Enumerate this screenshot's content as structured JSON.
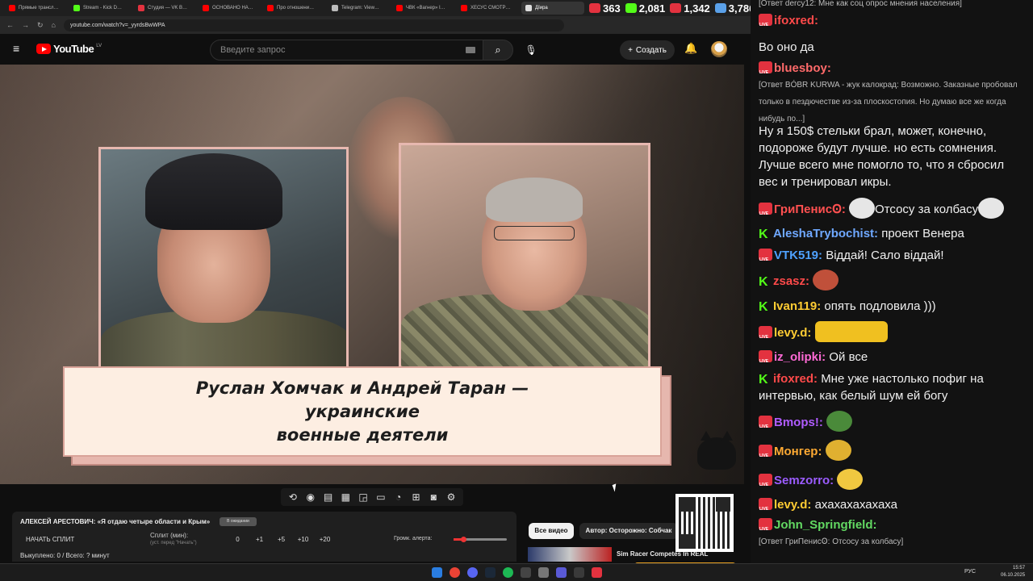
{
  "browser": {
    "tabs": [
      {
        "label": "Прямые трансл…",
        "color": "#ff0000"
      },
      {
        "label": "Stream - Kick D…",
        "color": "#53fc18"
      },
      {
        "label": "Студия — VK В…",
        "color": "#e3323f"
      },
      {
        "label": "ОСНОВАНО НА…",
        "color": "#ff0000"
      },
      {
        "label": "Про отношени…",
        "color": "#ff0000"
      },
      {
        "label": "Telegram: View…",
        "color": "#bbbbbb"
      },
      {
        "label": "ЧВК «Вагнер» I…",
        "color": "#ff0000"
      },
      {
        "label": "ХЕСУС СМОТР…",
        "color": "#ff0000"
      },
      {
        "label": "Дїира",
        "color": "#dddddd"
      }
    ],
    "url": "youtube.com/watch?v=_yyrdsBwWPA"
  },
  "stream_stats": [
    {
      "icon": "youtube-icon",
      "value": "363",
      "color": "#e3323f"
    },
    {
      "icon": "kick-icon",
      "value": "2,081",
      "color": "#53fc18"
    },
    {
      "icon": "vk-live-icon",
      "value": "1,342",
      "color": "#e3323f"
    },
    {
      "icon": "viewers-icon",
      "value": "3,786",
      "color": "#5aa0e8"
    }
  ],
  "youtube": {
    "logo": "YouTube",
    "country": "LV",
    "search_placeholder": "Введите запрос",
    "create_label": "Создать"
  },
  "video": {
    "caption_line1": "Руслан Хомчак и Андрей Таран — украинские",
    "caption_line2": "военные деятели"
  },
  "split_panel": {
    "title": "АЛЕКСЕЙ АРЕСТОВИЧ: «Я отдаю четыре области и Крым»",
    "badge": "В ожидании",
    "start_label": "НАЧАТЬ СПЛИТ",
    "split_min_label": "Сплит (мин):",
    "split_min_hint": "(уст. перед \"Начать\")",
    "buttons": [
      "0",
      "+1",
      "+5",
      "+10",
      "+20"
    ],
    "volume_label": "Громк. алерта:",
    "volume_level": 0.18,
    "summary": "Выкуплено: 0 / Всего: ? минут"
  },
  "recommendations": {
    "chip_all": "Все видео",
    "chip_author": "Автор: Осторожно: Собчак",
    "title": "Sim Racer Competes In REAL"
  },
  "chat": [
    {
      "platform": "live",
      "user": "ifoxred:",
      "color": "#ff4a4a",
      "text": "",
      "reply": "[Ответ dercy12: Мне как соц опрос мнения населения]"
    },
    {
      "platform": "none",
      "user": "",
      "color": "",
      "text": "Во оно да",
      "reply": ""
    },
    {
      "platform": "live",
      "user": "bluesboy:",
      "color": "#ff6a6a",
      "text": "",
      "reply": "[Ответ BÓBR KURWA - жук калокрад: Возможно. Заказные пробовал только в пездючестве из-за плоскостопия. Но думаю все же когда нибудь по...]"
    },
    {
      "platform": "none",
      "user": "",
      "color": "",
      "text": "Ну я 150$ стельки брал, может, конечно, подороже будут лучше. но есть сомнения. Лучше всего мне помогло то, что я сбросил вес и тренировал икры.",
      "reply": ""
    },
    {
      "platform": "live",
      "user": "ГриПенисꙨ:",
      "color": "#ff5050",
      "text": "Отсосу за колбасу",
      "reply": ""
    },
    {
      "platform": "kick",
      "user": "AleshaTrybochist:",
      "color": "#6fa8ff",
      "text": "проект Венера",
      "reply": ""
    },
    {
      "platform": "live",
      "user": "VTK519:",
      "color": "#4fa2ff",
      "text": "Віддай! Сало віддай!",
      "reply": ""
    },
    {
      "platform": "kick",
      "user": "zsasz:",
      "color": "#ff4a4a",
      "text": "",
      "reply": ""
    },
    {
      "platform": "kick",
      "user": "Ivan119:",
      "color": "#ffcc33",
      "text": "опять подловила )))",
      "reply": ""
    },
    {
      "platform": "live",
      "user": "levy.d:",
      "color": "#ffcc33",
      "text": "",
      "reply": ""
    },
    {
      "platform": "live",
      "user": "iz_olipki:",
      "color": "#ff6ad5",
      "text": "Ой все",
      "reply": ""
    },
    {
      "platform": "kick",
      "user": "ifoxred:",
      "color": "#ff4a4a",
      "text": "Мне уже настолько пофиг на интервью, как белый шум ей богу",
      "reply": ""
    },
    {
      "platform": "live",
      "user": "Вmops!:",
      "color": "#b05cff",
      "text": "",
      "reply": ""
    },
    {
      "platform": "live",
      "user": "Монгер:",
      "color": "#ffaa33",
      "text": "",
      "reply": ""
    },
    {
      "platform": "live",
      "user": "Semzorro:",
      "color": "#9b5cff",
      "text": "",
      "reply": ""
    },
    {
      "platform": "live",
      "user": "levy.d:",
      "color": "#ffcc33",
      "text": "ахахахахахаха",
      "reply": ""
    },
    {
      "platform": "live",
      "user": "John_Springfield:",
      "color": "#62d962",
      "text": "",
      "reply": "[Ответ ГриПенисꙨ: Отсосу за колбасу]"
    }
  ],
  "taskbar": {
    "lang": "РУС",
    "time": "15:57",
    "date": "06.10.2025"
  }
}
